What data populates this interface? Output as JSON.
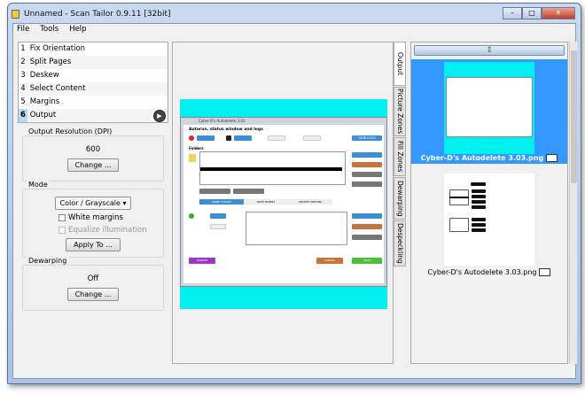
{
  "window": {
    "title": "Unnamed - Scan Tailor 0.9.11 [32bit]",
    "minimize": "–",
    "maximize": "□",
    "close": "✕"
  },
  "menu": [
    "File",
    "Tools",
    "Help"
  ],
  "stages": [
    {
      "n": "1",
      "label": "Fix Orientation"
    },
    {
      "n": "2",
      "label": "Split Pages"
    },
    {
      "n": "3",
      "label": "Deskew"
    },
    {
      "n": "4",
      "label": "Select Content"
    },
    {
      "n": "5",
      "label": "Margins"
    },
    {
      "n": "6",
      "label": "Output"
    }
  ],
  "output_resolution": {
    "label": "Output Resolution (DPI)",
    "value": "600",
    "button": "Change ..."
  },
  "mode": {
    "label": "Mode",
    "selected": "Color / Grayscale",
    "white_margins": "White margins",
    "equalize": "Equalize illumination",
    "apply": "Apply To ..."
  },
  "dewarping": {
    "label": "Dewarping",
    "value": "Off",
    "button": "Change ..."
  },
  "tabs": [
    "Output",
    "Picture Zones",
    "Fill Zones",
    "Dewarping",
    "Despeckling"
  ],
  "preview": {
    "window_title": "Cyber-D's Autodelete 3.03",
    "heading": "Autorun, status window and logs",
    "folders": "Folders",
    "view_logs": "VIEW LOGS",
    "tabs": [
      "NAME FILTERS",
      "DATE FILTERS",
      "DELETE OPTIONS"
    ],
    "donate": "DONATE",
    "cancel": "CANCEL",
    "save": "SAVE"
  },
  "thumbnails": [
    {
      "caption": "Cyber-D's Autodelete 3.03.png"
    },
    {
      "caption": "Cyber-D's Autodelete 3.03.png"
    }
  ],
  "colors": {
    "selection": "#3399ff",
    "cyan": "#00f0f0"
  }
}
